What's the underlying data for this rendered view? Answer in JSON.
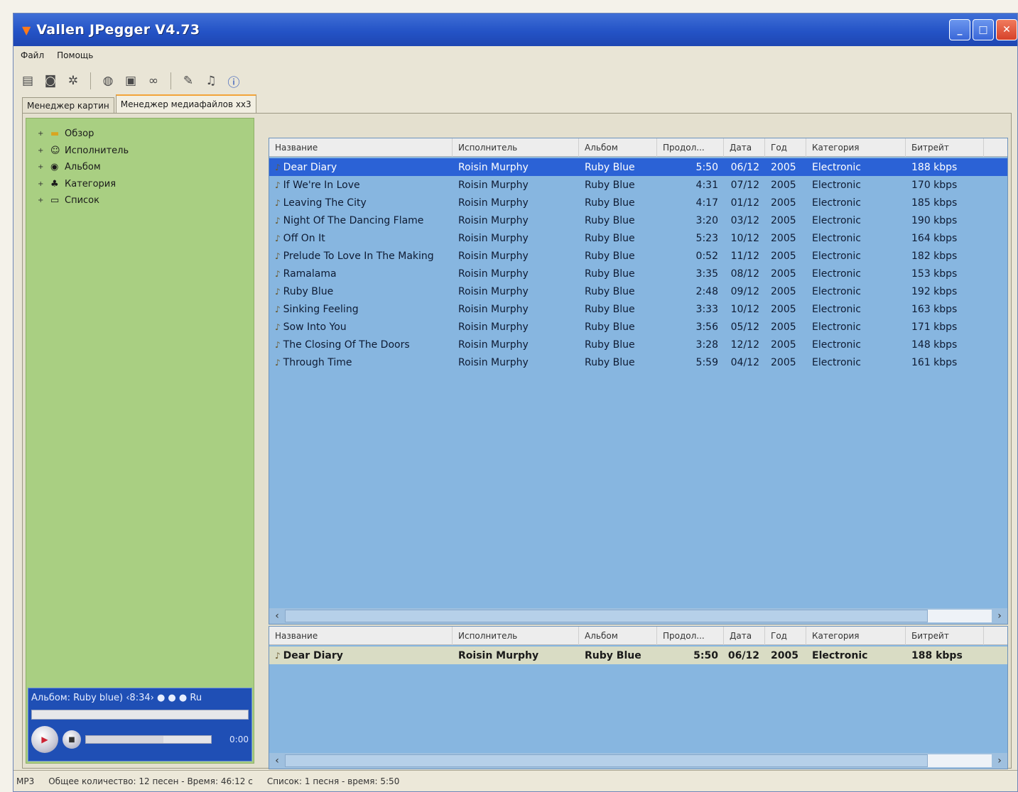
{
  "window": {
    "title": "Vallen JPegger V4.73",
    "buttons": {
      "minimize": "_",
      "maximize": "□",
      "close": "✕"
    }
  },
  "menu": [
    "Файл",
    "Помощь"
  ],
  "toolbar": {
    "icons": [
      "open-folder-icon",
      "camera-icon",
      "settings-icon",
      "separator",
      "photo-icon",
      "monitor-icon",
      "binoculars-icon",
      "separator",
      "pen-icon",
      "audio-icon",
      "info-icon"
    ]
  },
  "tabs": [
    "Менеджер картин",
    "Менеджер медиафайлов xx3"
  ],
  "tree": {
    "items": [
      {
        "label": "Обзор",
        "icon": "folder-icon"
      },
      {
        "label": "Исполнитель",
        "icon": "people-icon"
      },
      {
        "label": "Альбом",
        "icon": "disc-icon"
      },
      {
        "label": "Категория",
        "icon": "tag-icon"
      },
      {
        "label": "Список",
        "icon": "list-icon"
      }
    ]
  },
  "player": {
    "label": "Альбом: Ruby blue) ‹8:34› ● ● ● Ru",
    "time": "0:00",
    "volume_fraction": 0.62
  },
  "columns": [
    "Название",
    "Исполнитель",
    "Альбом",
    "Продол...",
    "Дата",
    "Год",
    "Категория",
    "Битрейт"
  ],
  "tracks": [
    {
      "name": "Dear Diary",
      "artist": "Roisin Murphy",
      "album": "Ruby Blue",
      "duration": "5:50",
      "date": "06/12",
      "year": "2005",
      "genre": "Electronic",
      "bitrate": "188 kbps"
    },
    {
      "name": "If We're In Love",
      "artist": "Roisin Murphy",
      "album": "Ruby Blue",
      "duration": "4:31",
      "date": "07/12",
      "year": "2005",
      "genre": "Electronic",
      "bitrate": "170 kbps"
    },
    {
      "name": "Leaving The City",
      "artist": "Roisin Murphy",
      "album": "Ruby Blue",
      "duration": "4:17",
      "date": "01/12",
      "year": "2005",
      "genre": "Electronic",
      "bitrate": "185 kbps"
    },
    {
      "name": "Night Of The Dancing Flame",
      "artist": "Roisin Murphy",
      "album": "Ruby Blue",
      "duration": "3:20",
      "date": "03/12",
      "year": "2005",
      "genre": "Electronic",
      "bitrate": "190 kbps"
    },
    {
      "name": "Off On It",
      "artist": "Roisin Murphy",
      "album": "Ruby Blue",
      "duration": "5:23",
      "date": "10/12",
      "year": "2005",
      "genre": "Electronic",
      "bitrate": "164 kbps"
    },
    {
      "name": "Prelude To Love In The Making",
      "artist": "Roisin Murphy",
      "album": "Ruby Blue",
      "duration": "0:52",
      "date": "11/12",
      "year": "2005",
      "genre": "Electronic",
      "bitrate": "182 kbps"
    },
    {
      "name": "Ramalama",
      "artist": "Roisin Murphy",
      "album": "Ruby Blue",
      "duration": "3:35",
      "date": "08/12",
      "year": "2005",
      "genre": "Electronic",
      "bitrate": "153 kbps"
    },
    {
      "name": "Ruby Blue",
      "artist": "Roisin Murphy",
      "album": "Ruby Blue",
      "duration": "2:48",
      "date": "09/12",
      "year": "2005",
      "genre": "Electronic",
      "bitrate": "192 kbps"
    },
    {
      "name": "Sinking Feeling",
      "artist": "Roisin Murphy",
      "album": "Ruby Blue",
      "duration": "3:33",
      "date": "10/12",
      "year": "2005",
      "genre": "Electronic",
      "bitrate": "163 kbps"
    },
    {
      "name": "Sow Into You",
      "artist": "Roisin Murphy",
      "album": "Ruby Blue",
      "duration": "3:56",
      "date": "05/12",
      "year": "2005",
      "genre": "Electronic",
      "bitrate": "171 kbps"
    },
    {
      "name": "The Closing Of The Doors",
      "artist": "Roisin Murphy",
      "album": "Ruby Blue",
      "duration": "3:28",
      "date": "12/12",
      "year": "2005",
      "genre": "Electronic",
      "bitrate": "148 kbps"
    },
    {
      "name": "Through Time",
      "artist": "Roisin Murphy",
      "album": "Ruby Blue",
      "duration": "5:59",
      "date": "04/12",
      "year": "2005",
      "genre": "Electronic",
      "bitrate": "161 kbps"
    }
  ],
  "playlist": [
    {
      "name": "Dear Diary",
      "artist": "Roisin Murphy",
      "album": "Ruby Blue",
      "duration": "5:50",
      "date": "06/12",
      "year": "2005",
      "genre": "Electronic",
      "bitrate": "188 kbps"
    }
  ],
  "status": {
    "format": "MP3",
    "total": "Общее количество: 12 песен - Время: 46:12 с",
    "list": "Список: 1 песня - время: 5:50"
  },
  "colors": {
    "titlebar": "#2453c6",
    "tree_bg": "#a9cf82",
    "grid_bg": "#87b6e0",
    "selected_row": "#2b62d6"
  }
}
